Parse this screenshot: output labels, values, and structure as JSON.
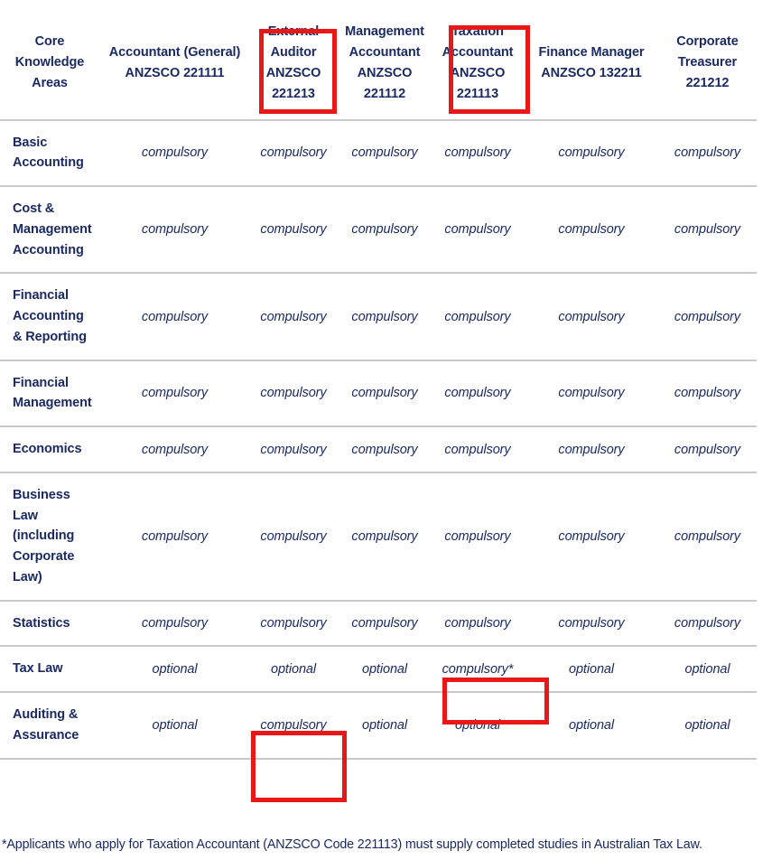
{
  "table": {
    "columns": [
      {
        "id": "area",
        "label": "Core\nKnowledge\nAreas",
        "lines": [
          "Core",
          "Knowledge",
          "Areas"
        ]
      },
      {
        "id": "acc",
        "label": "Accountant (General) ANZSCO 221111",
        "lines": [
          "Accountant (General)",
          "ANZSCO 221111"
        ]
      },
      {
        "id": "ext",
        "label": "External Auditor ANZSCO 221213",
        "lines": [
          "External",
          "Auditor",
          "ANZSCO",
          "221213"
        ]
      },
      {
        "id": "mgmt",
        "label": "Management Accountant ANZSCO 221112",
        "lines": [
          "Management",
          "Accountant",
          "ANZSCO",
          "221112"
        ]
      },
      {
        "id": "tax",
        "label": "Taxation Accountant ANZSCO 221113",
        "lines": [
          "Taxation",
          "Accountant",
          "ANZSCO",
          "221113"
        ]
      },
      {
        "id": "fin",
        "label": "Finance Manager ANZSCO 132211",
        "lines": [
          "Finance Manager",
          "ANZSCO 132211"
        ]
      },
      {
        "id": "corp",
        "label": "Corporate Treasurer 221212",
        "lines": [
          "Corporate",
          "Treasurer",
          "221212"
        ]
      }
    ],
    "header_lines": {
      "area": [
        "Core",
        "Knowledge",
        "Areas"
      ],
      "acc": [
        "Accountant (General)",
        "ANZSCO 221111"
      ],
      "ext": [
        "External",
        "Auditor",
        "ANZSCO",
        "221213"
      ],
      "mgmt": [
        "Management",
        "Accountant",
        "ANZSCO",
        "221112"
      ],
      "tax": [
        "Taxation",
        "Accountant",
        "ANZSCO",
        "221113"
      ],
      "fin": [
        "Finance Manager",
        "ANZSCO 132211"
      ],
      "corp": [
        "Corporate",
        "Treasurer",
        "221212"
      ]
    },
    "rows": [
      {
        "area_lines": [
          "Basic",
          "Accounting"
        ],
        "values": [
          "compulsory",
          "compulsory",
          "compulsory",
          "compulsory",
          "compulsory",
          "compulsory"
        ]
      },
      {
        "area_lines": [
          "Cost &",
          "Management",
          "Accounting"
        ],
        "values": [
          "compulsory",
          "compulsory",
          "compulsory",
          "compulsory",
          "compulsory",
          "compulsory"
        ]
      },
      {
        "area_lines": [
          "Financial",
          "Accounting",
          "& Reporting"
        ],
        "values": [
          "compulsory",
          "compulsory",
          "compulsory",
          "compulsory",
          "compulsory",
          "compulsory"
        ]
      },
      {
        "area_lines": [
          "Financial",
          "Management"
        ],
        "values": [
          "compulsory",
          "compulsory",
          "compulsory",
          "compulsory",
          "compulsory",
          "compulsory"
        ]
      },
      {
        "area_lines": [
          "Economics"
        ],
        "values": [
          "compulsory",
          "compulsory",
          "compulsory",
          "compulsory",
          "compulsory",
          "compulsory"
        ]
      },
      {
        "area_lines": [
          "Business",
          "Law",
          "(including",
          "Corporate",
          "Law)"
        ],
        "values": [
          "compulsory",
          "compulsory",
          "compulsory",
          "compulsory",
          "compulsory",
          "compulsory"
        ]
      },
      {
        "area_lines": [
          "Statistics"
        ],
        "values": [
          "compulsory",
          "compulsory",
          "compulsory",
          "compulsory",
          "compulsory",
          "compulsory"
        ]
      },
      {
        "area_lines": [
          "Tax Law"
        ],
        "values": [
          "optional",
          "optional",
          "optional",
          "compulsory*",
          "optional",
          "optional"
        ]
      },
      {
        "area_lines": [
          "Auditing &",
          "Assurance"
        ],
        "values": [
          "optional",
          "compulsory",
          "optional",
          "optional",
          "optional",
          "optional"
        ]
      }
    ]
  },
  "footnote": {
    "text": "*Applicants who apply for Taxation Accountant (ANZSCO Code 221113) must supply completed studies in Australian Tax Law."
  },
  "highlights": [
    {
      "name": "external-auditor-header",
      "target": "External Auditor ANZSCO 221213 column header"
    },
    {
      "name": "taxation-accountant-header",
      "target": "Taxation Accountant ANZSCO 221113 column header"
    },
    {
      "name": "tax-law-taxation-cell",
      "target": "Tax Law / Taxation Accountant = compulsory*"
    },
    {
      "name": "auditing-external-auditor-cell",
      "target": "Auditing & Assurance / External Auditor = compulsory"
    }
  ],
  "colors": {
    "text_navy": "#1b2a63",
    "rule_gray": "#c9c9c9",
    "highlight_red": "#e81818",
    "background": "#ffffff"
  }
}
